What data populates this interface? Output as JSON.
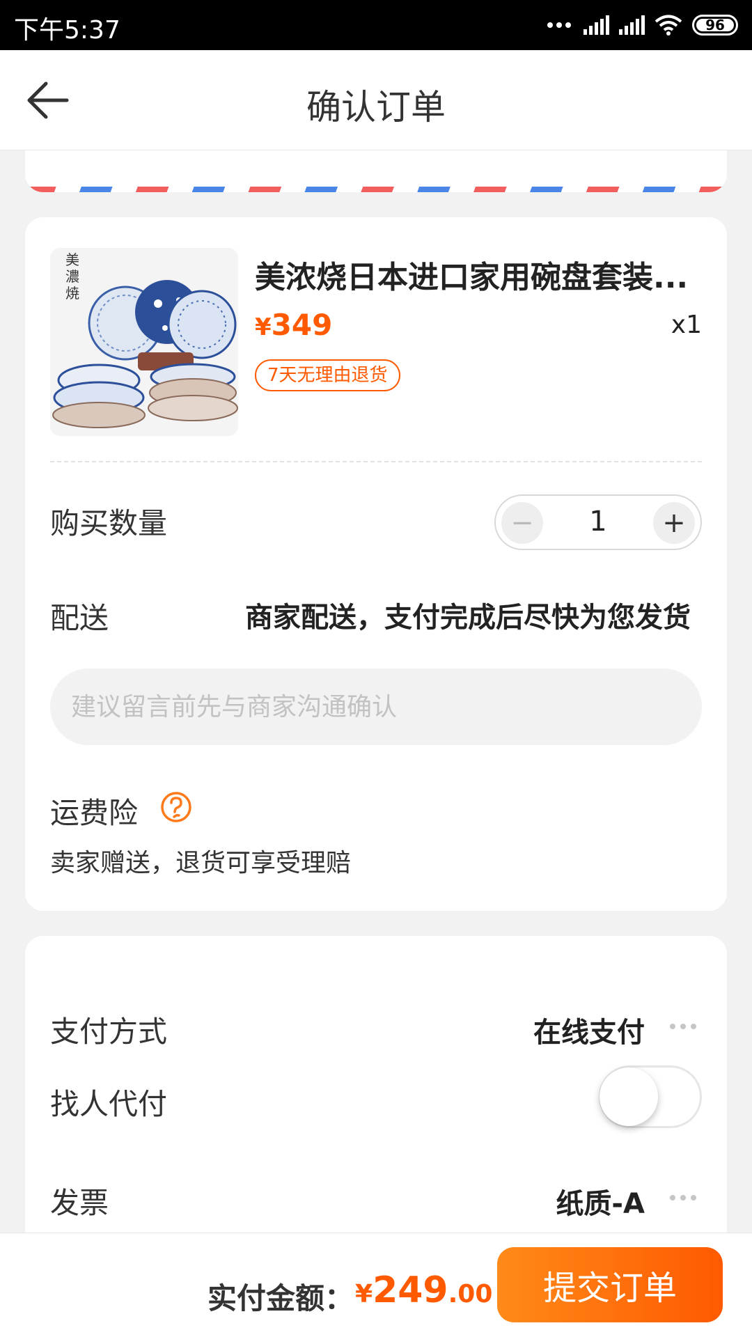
{
  "status_bar": {
    "time": "下午5:37",
    "battery": "96"
  },
  "header": {
    "title": "确认订单"
  },
  "product": {
    "name": "美浓烧日本进口家用碗盘套装...",
    "price_symbol": "¥",
    "price": "349",
    "quantity_text": "x1",
    "tag": "7天无理由退货"
  },
  "quantity": {
    "label": "购买数量",
    "value": "1",
    "minus": "−",
    "plus": "+"
  },
  "delivery": {
    "label": "配送",
    "value": "商家配送，支付完成后尽快为您发货"
  },
  "note": {
    "placeholder": "建议留言前先与商家沟通确认"
  },
  "insurance": {
    "label": "运费险",
    "desc": "卖家赠送，退货可享受理赔"
  },
  "payment": {
    "label": "支付方式",
    "value": "在线支付"
  },
  "proxy_pay": {
    "label": "找人代付",
    "enabled": false
  },
  "invoice": {
    "label": "发票",
    "value": "纸质-A"
  },
  "footer": {
    "total_label": "实付金额：",
    "currency": "¥",
    "amount_int": "249",
    "amount_dec": ".00",
    "submit_label": "提交订单"
  },
  "colors": {
    "accent": "#ff5a00",
    "stripe_red": "#f25d5d",
    "stripe_blue": "#4a86e8"
  }
}
